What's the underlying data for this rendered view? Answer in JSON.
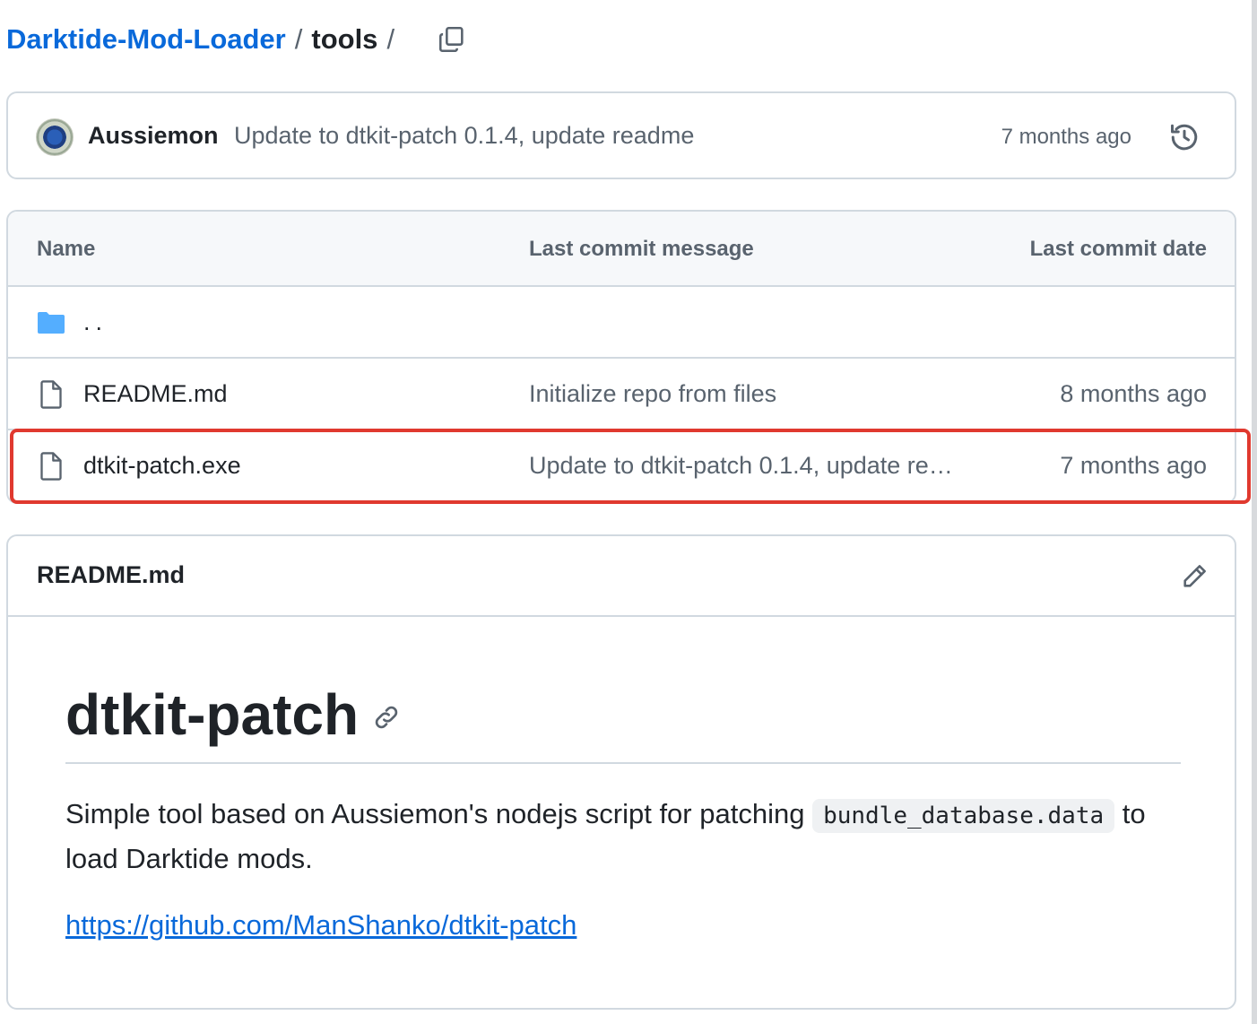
{
  "breadcrumb": {
    "repo": "Darktide-Mod-Loader",
    "separator": "/",
    "folder": "tools",
    "trailing_separator": "/"
  },
  "commit": {
    "author": "Aussiemon",
    "message": "Update to dtkit-patch 0.1.4, update readme",
    "time": "7 months ago",
    "history_icon": "history-icon"
  },
  "table": {
    "headers": {
      "name": "Name",
      "message": "Last commit message",
      "date": "Last commit date"
    },
    "parent_dir": "..",
    "rows": [
      {
        "name": "README.md",
        "message": "Initialize repo from files",
        "date": "8 months ago",
        "icon": "file-icon"
      },
      {
        "name": "dtkit-patch.exe",
        "message": "Update to dtkit-patch 0.1.4, update re…",
        "date": "7 months ago",
        "icon": "file-icon"
      }
    ]
  },
  "readme": {
    "title": "README.md",
    "heading": "dtkit-patch",
    "para_before": "Simple tool based on Aussiemon's nodejs script for patching ",
    "code": "bundle_database.data",
    "para_after": " to load Darktide mods.",
    "link": "https://github.com/ManShanko/dtkit-patch"
  },
  "colors": {
    "link": "#0969da",
    "border": "#d1d9e0",
    "muted": "#59636e",
    "highlight": "#e0392f",
    "folder": "#54aeff"
  }
}
